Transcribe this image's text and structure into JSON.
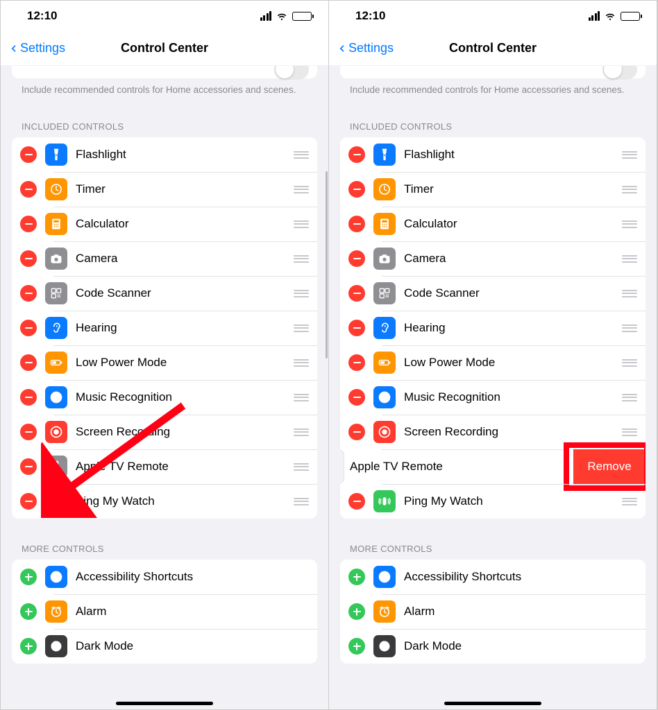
{
  "status": {
    "time": "12:10"
  },
  "nav": {
    "back": "Settings",
    "title": "Control Center"
  },
  "footer_text": "Include recommended controls for Home accessories and scenes.",
  "sections": {
    "included_header": "INCLUDED CONTROLS",
    "more_header": "MORE CONTROLS"
  },
  "included": [
    {
      "label": "Flashlight",
      "icon": "flashlight",
      "bg": "#0a7aff"
    },
    {
      "label": "Timer",
      "icon": "timer",
      "bg": "#ff9500"
    },
    {
      "label": "Calculator",
      "icon": "calculator",
      "bg": "#ff9500"
    },
    {
      "label": "Camera",
      "icon": "camera",
      "bg": "#8e8e93"
    },
    {
      "label": "Code Scanner",
      "icon": "qrcode",
      "bg": "#8e8e93"
    },
    {
      "label": "Hearing",
      "icon": "ear",
      "bg": "#0a7aff"
    },
    {
      "label": "Low Power Mode",
      "icon": "battery",
      "bg": "#ff9500"
    },
    {
      "label": "Music Recognition",
      "icon": "shazam",
      "bg": "#0a7aff"
    },
    {
      "label": "Screen Recording",
      "icon": "record",
      "bg": "#ff3b30"
    },
    {
      "label": "Apple TV Remote",
      "icon": "remote",
      "bg": "#8e8e93"
    },
    {
      "label": "Ping My Watch",
      "icon": "ping",
      "bg": "#34c759"
    }
  ],
  "more": [
    {
      "label": "Accessibility Shortcuts",
      "icon": "accessibility",
      "bg": "#0a7aff"
    },
    {
      "label": "Alarm",
      "icon": "alarm",
      "bg": "#ff9500"
    },
    {
      "label": "Dark Mode",
      "icon": "darkmode",
      "bg": "#3a3a3c"
    }
  ],
  "remove_button": "Remove"
}
